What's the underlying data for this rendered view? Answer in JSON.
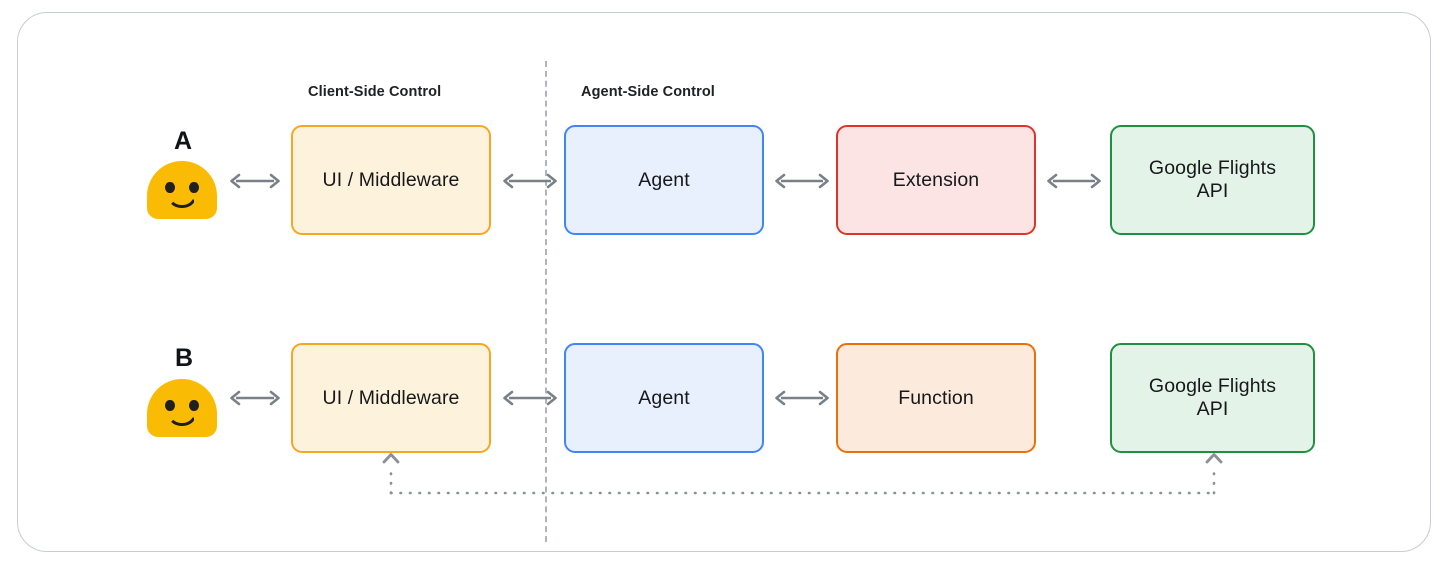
{
  "diagram": {
    "sections": {
      "client": "Client-Side Control",
      "agent": "Agent-Side Control"
    },
    "rows": [
      {
        "letter": "A",
        "user_icon": "smiley-face-avatar",
        "nodes": [
          {
            "label": "UI / Middleware",
            "color": "#F5A623",
            "fill": "#FDF3DC"
          },
          {
            "label": "Agent",
            "color": "#4285F4",
            "fill": "#E8EFFD"
          },
          {
            "label": "Extension",
            "color": "#E0342B",
            "fill": "#FBE4E3"
          },
          {
            "label": "Google Flights\nAPI",
            "line1": "Google Flights",
            "line2": "API",
            "color": "#1E9141",
            "fill": "#E4F3E7"
          }
        ],
        "connectors": [
          "bidirectional-arrow",
          "bidirectional-arrow",
          "bidirectional-arrow",
          "bidirectional-arrow"
        ]
      },
      {
        "letter": "B",
        "user_icon": "smiley-face-avatar",
        "nodes": [
          {
            "label": "UI / Middleware",
            "color": "#F5A623",
            "fill": "#FDF3DC"
          },
          {
            "label": "Agent",
            "color": "#4285F4",
            "fill": "#E8EFFD"
          },
          {
            "label": "Function",
            "color": "#E8710A",
            "fill": "#FCEBDC"
          },
          {
            "label": "Google Flights\nAPI",
            "line1": "Google Flights",
            "line2": "API",
            "color": "#1E9141",
            "fill": "#E4F3E7"
          }
        ],
        "connectors": [
          "bidirectional-arrow",
          "bidirectional-arrow",
          "bidirectional-arrow"
        ],
        "feedback_path": {
          "style": "dotted",
          "from": "Google Flights API",
          "to": "UI / Middleware",
          "color": "#8b9098"
        }
      }
    ],
    "colors": {
      "container_border": "#c8ccd4",
      "divider": "#b0b4bb",
      "arrow": "#7a8088",
      "avatar": "#FABB05",
      "text": "#17181b"
    }
  }
}
